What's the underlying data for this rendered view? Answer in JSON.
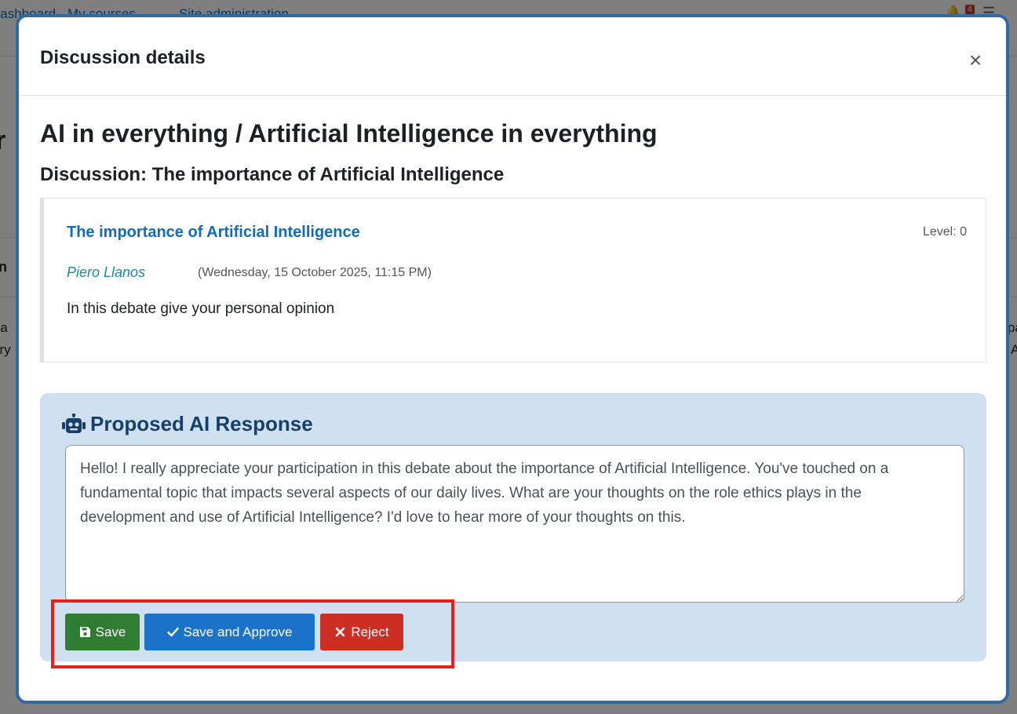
{
  "background": {
    "nav_links": [
      "Dashboard",
      "My courses",
      "Site administration"
    ],
    "notification_count": "4",
    "heading_fragment": "r",
    "fragments": [
      "n",
      "cia",
      "ery",
      "pa",
      "A"
    ]
  },
  "modal": {
    "title": "Discussion details",
    "close_label": "×",
    "heading": "AI in everything / Artificial Intelligence in everything",
    "subheading": "Discussion: The importance of Artificial Intelligence",
    "post": {
      "title": "The importance of Artificial Intelligence",
      "level": "Level: 0",
      "author": "Piero Llanos",
      "date": "(Wednesday, 15 October 2025, 11:15 PM)",
      "body": "In this debate give your personal opinion"
    },
    "ai_response": {
      "title": "Proposed AI Response",
      "text": "Hello! I really appreciate your participation in this debate about the importance of Artificial Intelligence. You've touched on a fundamental topic that impacts several aspects of our daily lives. What are your thoughts on the role ethics plays in the development and use of Artificial Intelligence? I'd love to hear more of your thoughts on this."
    },
    "buttons": {
      "save": "Save",
      "save_approve": "Save and Approve",
      "reject": "Reject"
    }
  },
  "colors": {
    "modal_border": "#2f6aa5",
    "link": "#0f6cbf",
    "author": "#1a8a9a",
    "ai_panel_bg": "#cfe0f0",
    "ai_title": "#183f6a",
    "save_button": "#2e7d32",
    "approve_button": "#1a73c8",
    "reject_button": "#cc2e24",
    "highlight_box": "#e0241b"
  },
  "icons": {
    "ai_title": "robot-icon",
    "save": "floppy-disk-icon",
    "save_approve": "check-icon",
    "reject": "x-icon",
    "close": "close-icon"
  }
}
